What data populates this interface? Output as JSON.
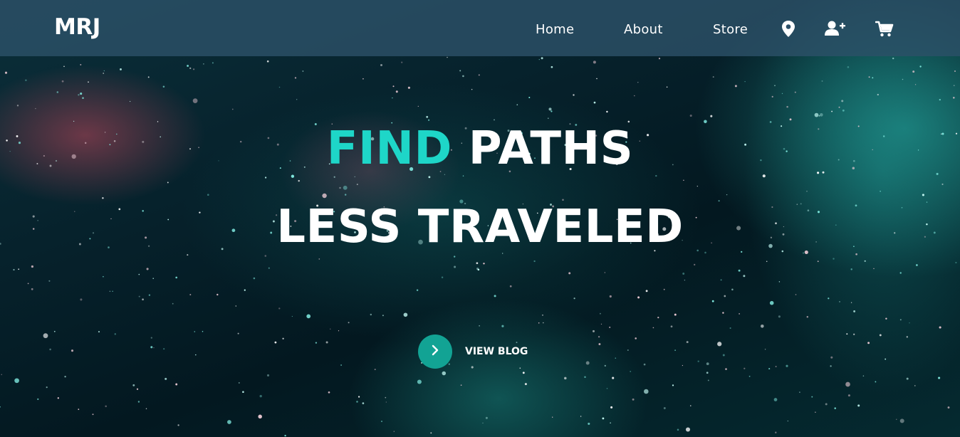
{
  "nav": {
    "logo": "MRJ",
    "links": [
      {
        "label": "Home"
      },
      {
        "label": "About"
      },
      {
        "label": "Store"
      }
    ],
    "icons": [
      "location-pin-icon",
      "add-user-icon",
      "cart-icon"
    ]
  },
  "hero": {
    "headline_accent": "FIND",
    "headline_rest": "PATHS",
    "headline_line2": "LESS TRAVELED",
    "cta_label": "VIEW BLOG"
  },
  "colors": {
    "accent": "#1ed6c8",
    "cta": "#12a394",
    "nav_bg": "#2c5068",
    "hero_bg": "#05222a"
  }
}
